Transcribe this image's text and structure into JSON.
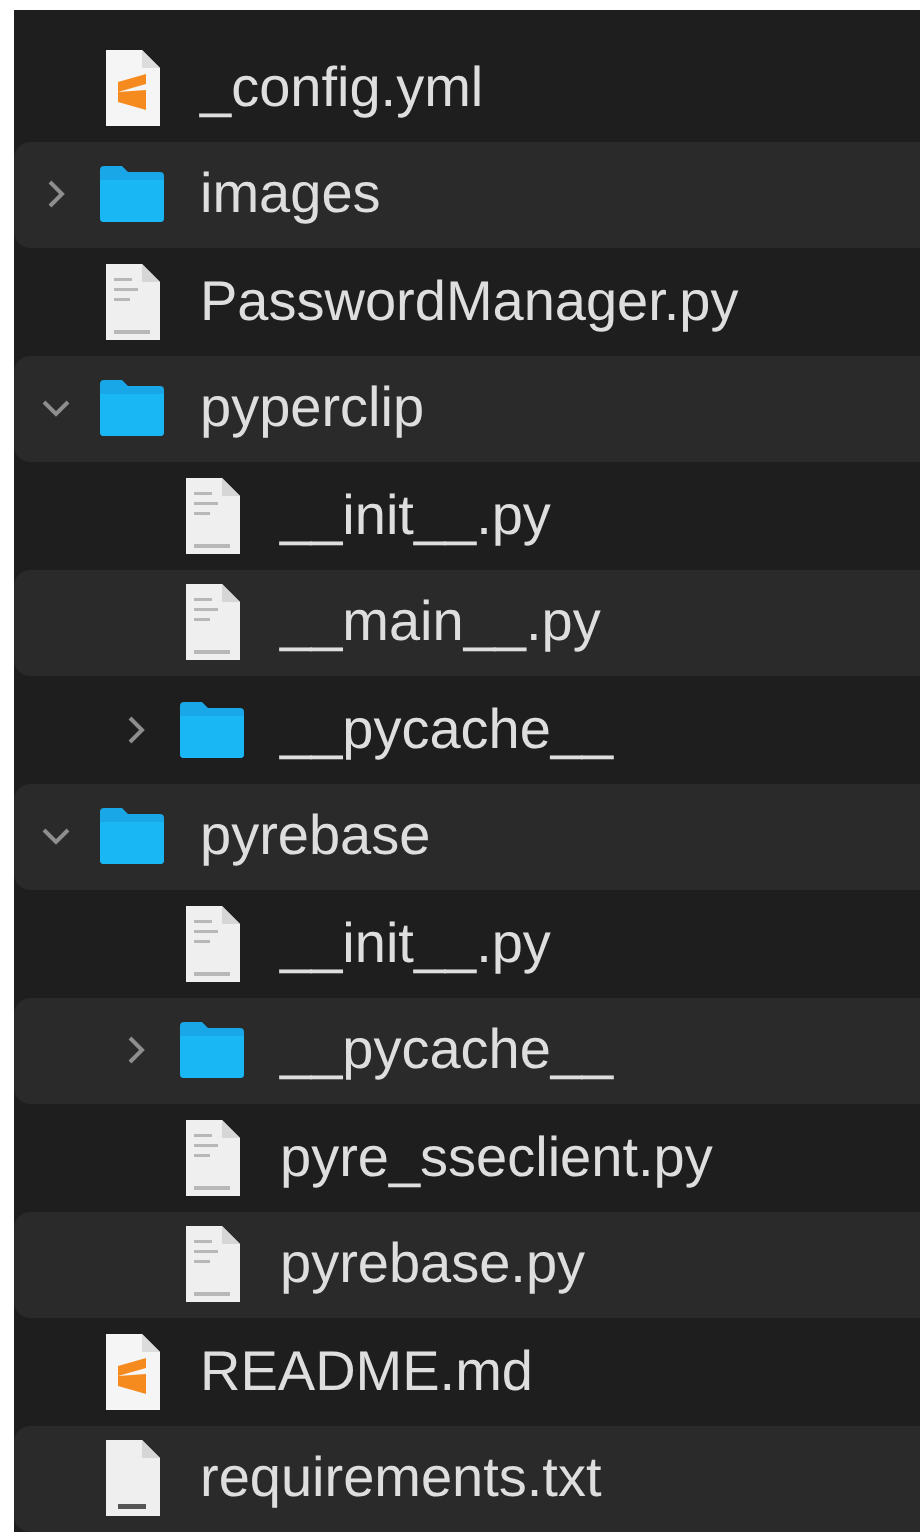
{
  "tree": [
    {
      "name": "_config.yml",
      "kind": "sublime"
    },
    {
      "name": "images",
      "kind": "folder",
      "expanded": false
    },
    {
      "name": "PasswordManager.py",
      "kind": "python"
    },
    {
      "name": "pyperclip",
      "kind": "folder",
      "expanded": true,
      "children": [
        {
          "name": "__init__.py",
          "kind": "python"
        },
        {
          "name": "__main__.py",
          "kind": "python"
        },
        {
          "name": "__pycache__",
          "kind": "folder",
          "expanded": false
        }
      ]
    },
    {
      "name": "pyrebase",
      "kind": "folder",
      "expanded": true,
      "children": [
        {
          "name": "__init__.py",
          "kind": "python"
        },
        {
          "name": "__pycache__",
          "kind": "folder",
          "expanded": false
        },
        {
          "name": "pyre_sseclient.py",
          "kind": "python"
        },
        {
          "name": "pyrebase.py",
          "kind": "python"
        }
      ]
    },
    {
      "name": "README.md",
      "kind": "sublime"
    },
    {
      "name": "requirements.txt",
      "kind": "text"
    }
  ]
}
